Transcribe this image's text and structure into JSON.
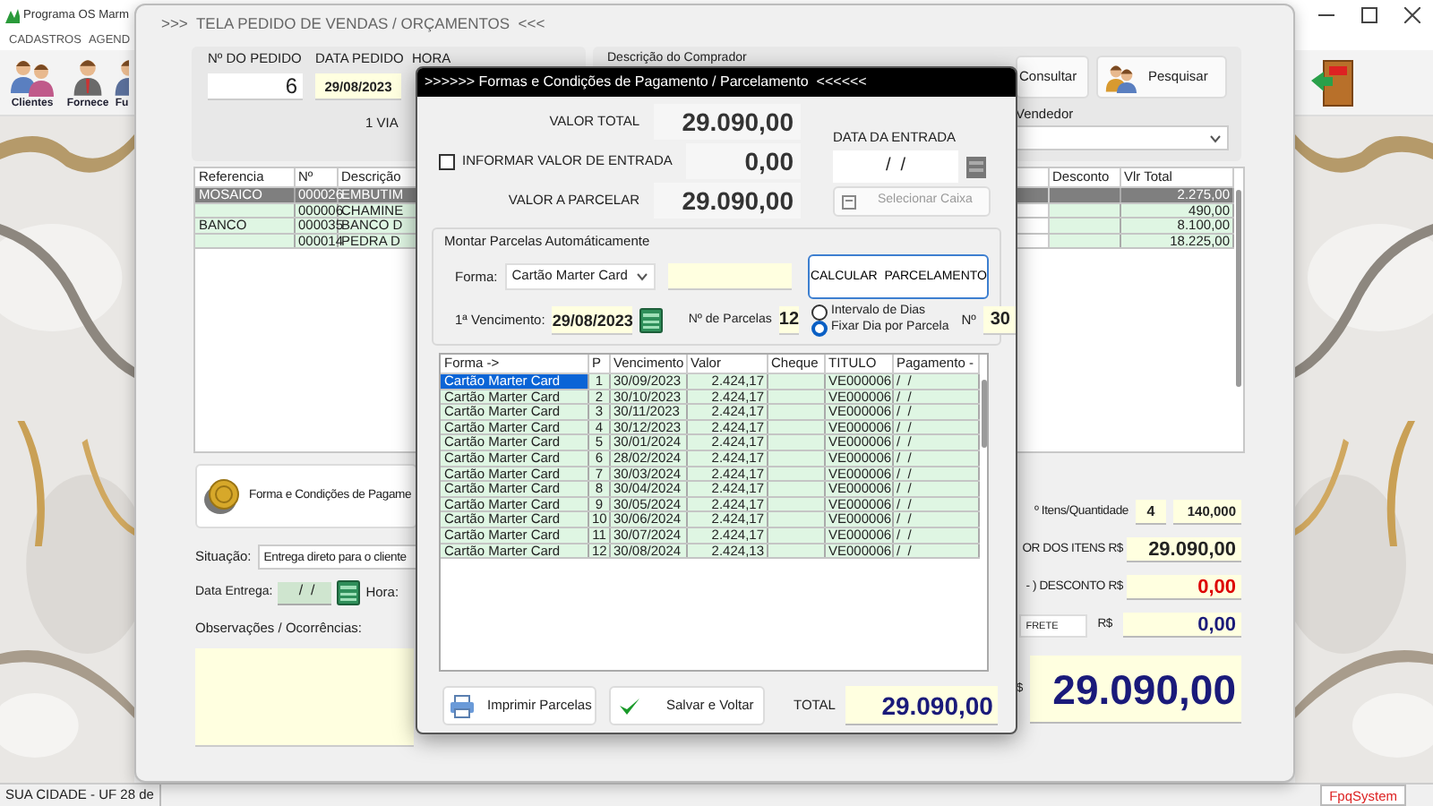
{
  "app": {
    "title": "Programa OS Marm",
    "menu": [
      "CADASTROS",
      "AGEND"
    ],
    "toolbar": [
      {
        "label": "Clientes",
        "kind": "clients"
      },
      {
        "label": "Fornece",
        "kind": "supplier"
      },
      {
        "label": "Fu",
        "kind": "person"
      }
    ],
    "status_bar": [
      "SUA CIDADE - UF 28 de",
      "FpqSystem"
    ]
  },
  "order_window": {
    "title": ">>>  TELA PEDIDO DE VENDAS / ORÇAMENTOS  <<<",
    "order_number_label": "Nº DO PEDIDO",
    "order_number": "6",
    "order_date_label": "DATA PEDIDO",
    "order_date": "29/08/2023",
    "time_label": "HORA",
    "copies": "1 VIA",
    "buyer_label": "Descrição do Comprador",
    "buttons": [
      "Consultar",
      "Pesquisar"
    ],
    "seller_label": "Vendedor",
    "items": {
      "columns": [
        "Referencia",
        "Nº",
        "Descrição",
        "Desconto",
        "Vlr Total"
      ],
      "rows": [
        {
          "cells": [
            "MOSAICO",
            "000026",
            "EMBUTIM",
            "",
            "2.275,00"
          ],
          "selected": true
        },
        {
          "cells": [
            "",
            "000006",
            "CHAMINE",
            "",
            "490,00"
          ],
          "selected": false
        },
        {
          "cells": [
            "BANCO",
            "000035",
            "BANCO D",
            "",
            "8.100,00"
          ],
          "selected": false
        },
        {
          "cells": [
            "",
            "000014",
            "PEDRA D",
            "",
            "18.225,00"
          ],
          "selected": false
        }
      ]
    },
    "payment_button": "Forma e Condições de Pagame",
    "situation_label": "Situação:",
    "situation": "Entrega direto para o cliente",
    "delivery_label": "Data Entrega:",
    "delivery_date": " /  /",
    "delivery_time_label": "Hora:",
    "notes_label": "Observações / Ocorrências:",
    "summary": {
      "count_label": "º Itens/Quantidade",
      "count": "4",
      "quantity": "140,000",
      "items_label": "OR DOS ITENS R$",
      "items_total": "29.090,00",
      "discount_label": "- ) DESCONTO R$",
      "discount": "0,00",
      "freight_field": "FRETE",
      "freight_currency": "R$",
      "freight": "0,00",
      "total_currency": "$",
      "total": "29.090,00"
    }
  },
  "payment_dialog": {
    "title": ">>>>>> Formas e Condições de Pagamento / Parcelamento  <<<<<<",
    "total_label": "VALOR TOTAL",
    "total": "29.090,00",
    "entry_checkbox": {
      "label": "INFORMAR VALOR DE ENTRADA",
      "checked": false
    },
    "entry_value": "0,00",
    "to_split_label": "VALOR A PARCELAR",
    "to_split": "29.090,00",
    "entry_date_label": "DATA DA ENTRADA",
    "entry_date": "/  /",
    "cash_button": {
      "label": "Selecionar Caixa",
      "disabled": true
    },
    "group_title": "Montar Parcelas Automáticamente",
    "method_label": "Forma:",
    "method": "Cartão Marter Card",
    "calc_button": "CALCULAR  PARCELAMENTO",
    "first_due_label": "1ª Vencimento:",
    "first_due": "29/08/2023",
    "installments_label": "Nº de Parcelas",
    "installments": "12",
    "modes": [
      {
        "label": "Intervalo de Dias",
        "selected": false
      },
      {
        "label": "Fixar Dia por Parcela",
        "selected": true
      }
    ],
    "day_label": "Nº",
    "day": "30",
    "table": {
      "columns": [
        "Forma ->",
        "P",
        "Vencimento",
        "Valor",
        "Cheque",
        "TITULO",
        "Pagamento -"
      ],
      "rows": [
        {
          "cells": [
            "Cartão Marter Card",
            "1",
            "30/09/2023",
            "2.424,17",
            "",
            "VE000006",
            "/  /"
          ],
          "selected": true
        },
        {
          "cells": [
            "Cartão Marter Card",
            "2",
            "30/10/2023",
            "2.424,17",
            "",
            "VE000006",
            "/  /"
          ],
          "selected": false
        },
        {
          "cells": [
            "Cartão Marter Card",
            "3",
            "30/11/2023",
            "2.424,17",
            "",
            "VE000006",
            "/  /"
          ],
          "selected": false
        },
        {
          "cells": [
            "Cartão Marter Card",
            "4",
            "30/12/2023",
            "2.424,17",
            "",
            "VE000006",
            "/  /"
          ],
          "selected": false
        },
        {
          "cells": [
            "Cartão Marter Card",
            "5",
            "30/01/2024",
            "2.424,17",
            "",
            "VE000006",
            "/  /"
          ],
          "selected": false
        },
        {
          "cells": [
            "Cartão Marter Card",
            "6",
            "28/02/2024",
            "2.424,17",
            "",
            "VE000006",
            "/  /"
          ],
          "selected": false
        },
        {
          "cells": [
            "Cartão Marter Card",
            "7",
            "30/03/2024",
            "2.424,17",
            "",
            "VE000006",
            "/  /"
          ],
          "selected": false
        },
        {
          "cells": [
            "Cartão Marter Card",
            "8",
            "30/04/2024",
            "2.424,17",
            "",
            "VE000006",
            "/  /"
          ],
          "selected": false
        },
        {
          "cells": [
            "Cartão Marter Card",
            "9",
            "30/05/2024",
            "2.424,17",
            "",
            "VE000006",
            "/  /"
          ],
          "selected": false
        },
        {
          "cells": [
            "Cartão Marter Card",
            "10",
            "30/06/2024",
            "2.424,17",
            "",
            "VE000006",
            "/  /"
          ],
          "selected": false
        },
        {
          "cells": [
            "Cartão Marter Card",
            "11",
            "30/07/2024",
            "2.424,17",
            "",
            "VE000006",
            "/  /"
          ],
          "selected": false
        },
        {
          "cells": [
            "Cartão Marter Card",
            "12",
            "30/08/2024",
            "2.424,13",
            "",
            "VE000006",
            "/  /"
          ],
          "selected": false
        }
      ]
    },
    "print_button": "Imprimir Parcelas",
    "save_button": "Salvar e Voltar",
    "grand_total_label": "TOTAL",
    "grand_total": "29.090,00"
  }
}
